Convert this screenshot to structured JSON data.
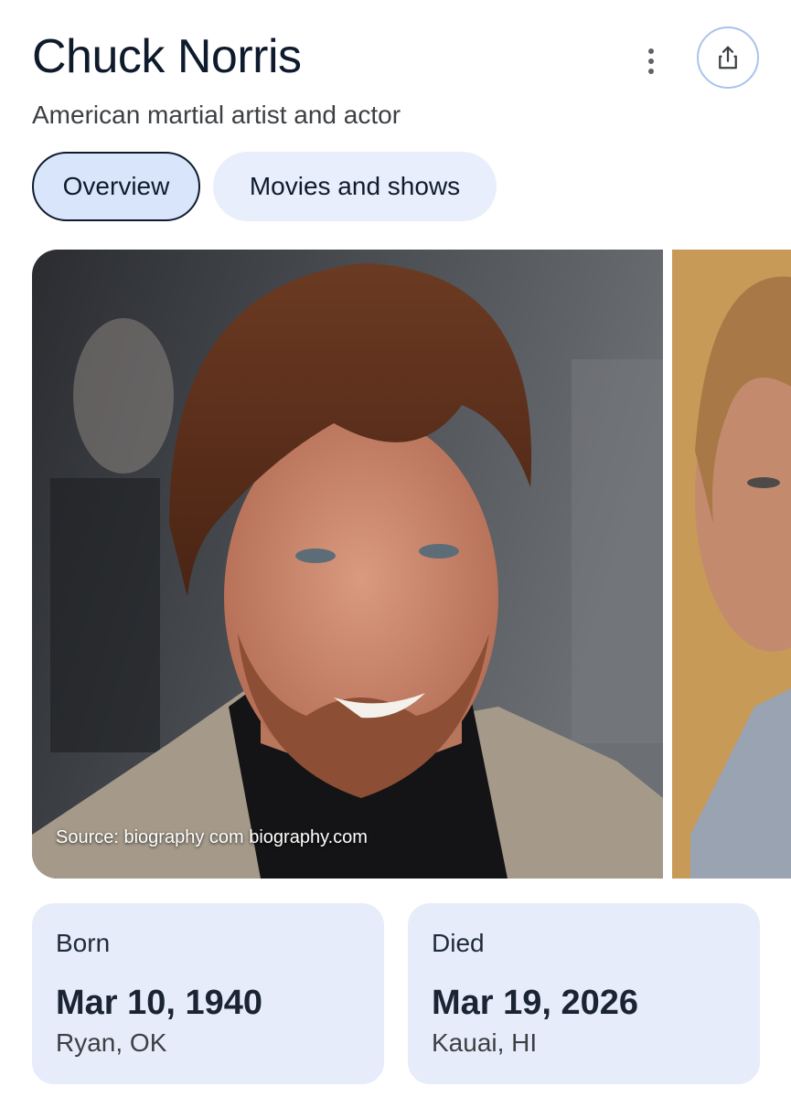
{
  "header": {
    "title": "Chuck Norris",
    "subtitle": "American martial artist and actor",
    "more_icon": "more-vert-icon",
    "share_icon": "share-icon"
  },
  "tabs": [
    {
      "label": "Overview",
      "selected": true
    },
    {
      "label": "Movies and shows",
      "selected": false
    }
  ],
  "photos": {
    "source_label": "Source: biography com biography.com"
  },
  "facts": {
    "born": {
      "label": "Born",
      "date": "Mar 10, 1940",
      "place": "Ryan, OK"
    },
    "died": {
      "label": "Died",
      "date": "Mar 19, 2026",
      "place": "Kauai, HI"
    }
  },
  "colors": {
    "selected_tab_bg": "#d9e5fb",
    "tab_bg": "#e8eefb",
    "card_bg": "#e6ecfa",
    "title": "#0f1b2d"
  }
}
